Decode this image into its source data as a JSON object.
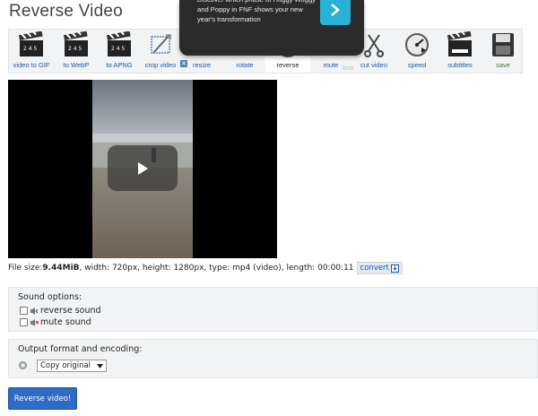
{
  "page": {
    "title": "Reverse Video"
  },
  "toolbar": {
    "items": [
      {
        "label": "video to GIF",
        "icon": "clapperboard-icon"
      },
      {
        "label": "to WebP",
        "icon": "clapperboard-icon"
      },
      {
        "label": "to APNG",
        "icon": "clapperboard-icon"
      },
      {
        "label": "crop video",
        "icon": "crop-icon"
      },
      {
        "label": "resize",
        "icon": "resize-icon"
      },
      {
        "label": "rotate",
        "icon": "rotate-icon"
      },
      {
        "label": "reverse",
        "icon": "rewind-icon"
      },
      {
        "label": "mute",
        "icon": "speaker-mute-icon"
      },
      {
        "label": "cut video",
        "icon": "scissors-icon"
      },
      {
        "label": "speed",
        "icon": "speedometer-icon"
      },
      {
        "label": "subtitles",
        "icon": "clapperboard-subtitles-icon"
      },
      {
        "label": "save",
        "icon": "floppy-disk-icon"
      }
    ],
    "overlay_fragment": "test"
  },
  "ad": {
    "text": "Discover which phase of Huggy Wuggy and Poppy in FNF shows your new year's transformation",
    "accent": "#2ab2d6"
  },
  "video": {
    "play_icon": "play-icon"
  },
  "file_info": {
    "prefix": "File size: ",
    "size": "9.44MiB",
    "rest": ", width: 720px, height: 1280px, type: mp4 (video), length: 00:00:11",
    "convert_label": "convert"
  },
  "sound_options": {
    "title": "Sound options:",
    "reverse_label": "reverse sound",
    "mute_label": "mute sound"
  },
  "output": {
    "title": "Output format and encoding:",
    "selected": "Copy original"
  },
  "submit_label": "Reverse video!",
  "colors": {
    "link": "#1a56b0",
    "button": "#2d6bc4",
    "panel": "#f1f3f5"
  }
}
